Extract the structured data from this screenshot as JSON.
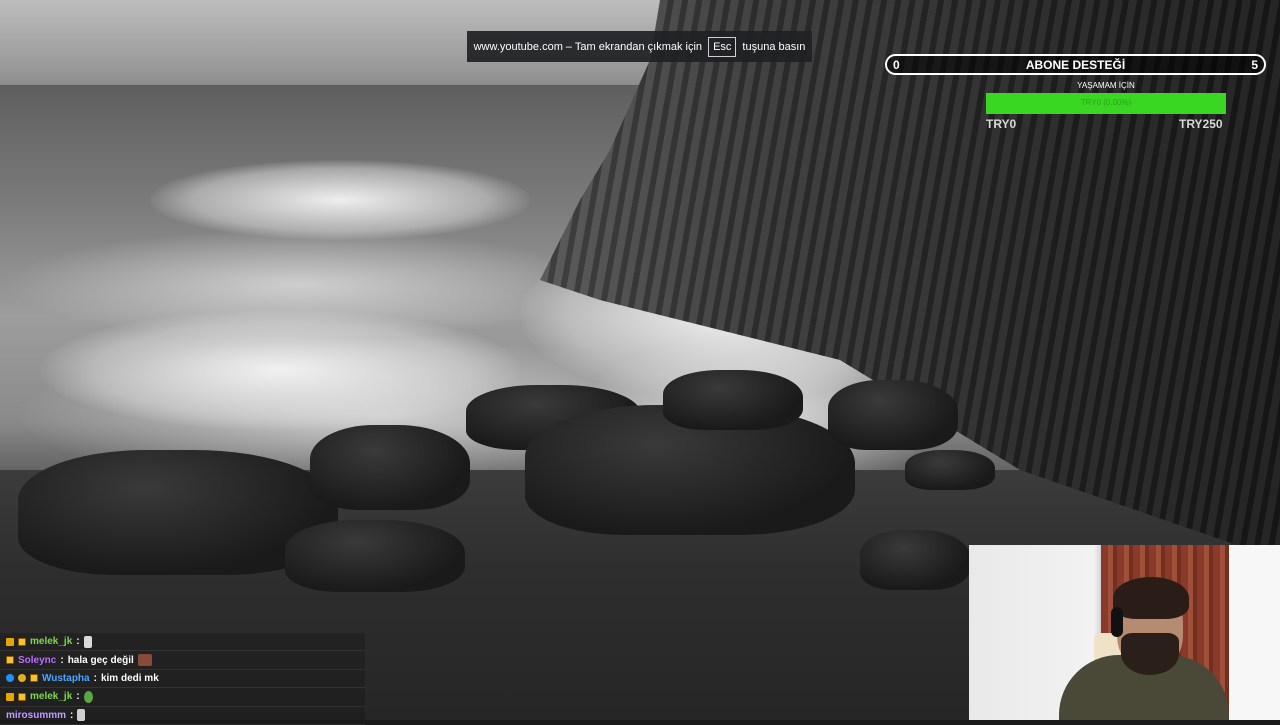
{
  "fullscreen_hint": {
    "prefix": "www.youtube.com – Tam ekrandan çıkmak için",
    "key": "Esc",
    "suffix": "tuşuna basın"
  },
  "sub_goal": {
    "title": "ABONE DESTEĞİ",
    "current": "0",
    "target": "5"
  },
  "donation_goal": {
    "label": "YAŞAMAM İÇİN",
    "inner_text": "TRY0 (0.00%)",
    "progress_percent": 100,
    "min": "TRY0",
    "max": "TRY250",
    "fill_color": "#39d622"
  },
  "chat": {
    "messages": [
      {
        "username": "melek_jk",
        "color": "#7fd84a",
        "separator": ":",
        "text": "",
        "emote": "cat-emote"
      },
      {
        "username": "Soleync",
        "color": "#b96cff",
        "separator": ":",
        "text": "hala geç değil",
        "emote": "pepe-emote"
      },
      {
        "username": "Wustapha",
        "color": "#4aa3ff",
        "separator": ":",
        "text": "kim dedi mk",
        "emote": ""
      },
      {
        "username": "melek_jk",
        "color": "#7fd84a",
        "separator": ":",
        "text": "",
        "emote": "frog-emote"
      },
      {
        "username": "mirosummm",
        "color": "#c49aff",
        "separator": ":",
        "text": "",
        "emote": "rook-emote"
      }
    ]
  },
  "colors": {
    "goal_border": "#ffffff",
    "hint_bg": "#202124"
  }
}
